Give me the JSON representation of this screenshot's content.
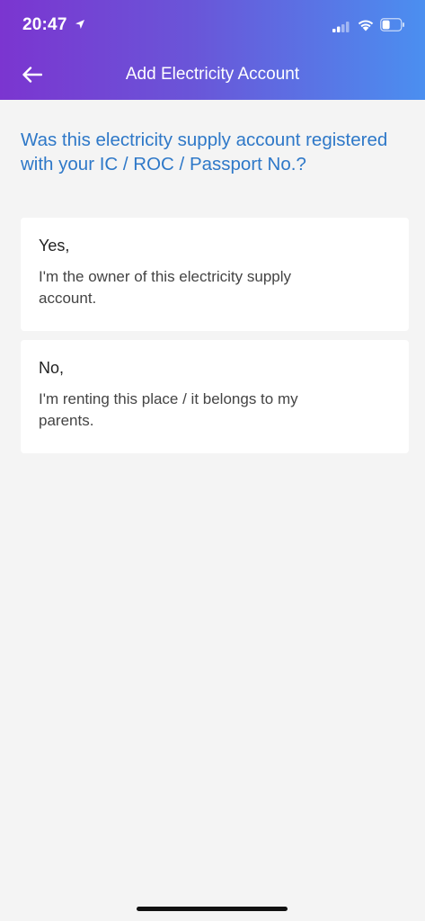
{
  "status_bar": {
    "time": "20:47"
  },
  "nav": {
    "title": "Add Electricity Account"
  },
  "question": "Was this electricity supply account registered with your IC / ROC / Passport No.?",
  "options": [
    {
      "title": "Yes,",
      "description": "I'm the owner of this electricity supply account."
    },
    {
      "title": "No,",
      "description": "I'm renting this place / it belongs to my parents."
    }
  ],
  "colors": {
    "header_gradient_start": "#7b35d0",
    "header_gradient_end": "#4b8ff0",
    "question_text": "#2e78c8",
    "background": "#f4f4f4"
  }
}
